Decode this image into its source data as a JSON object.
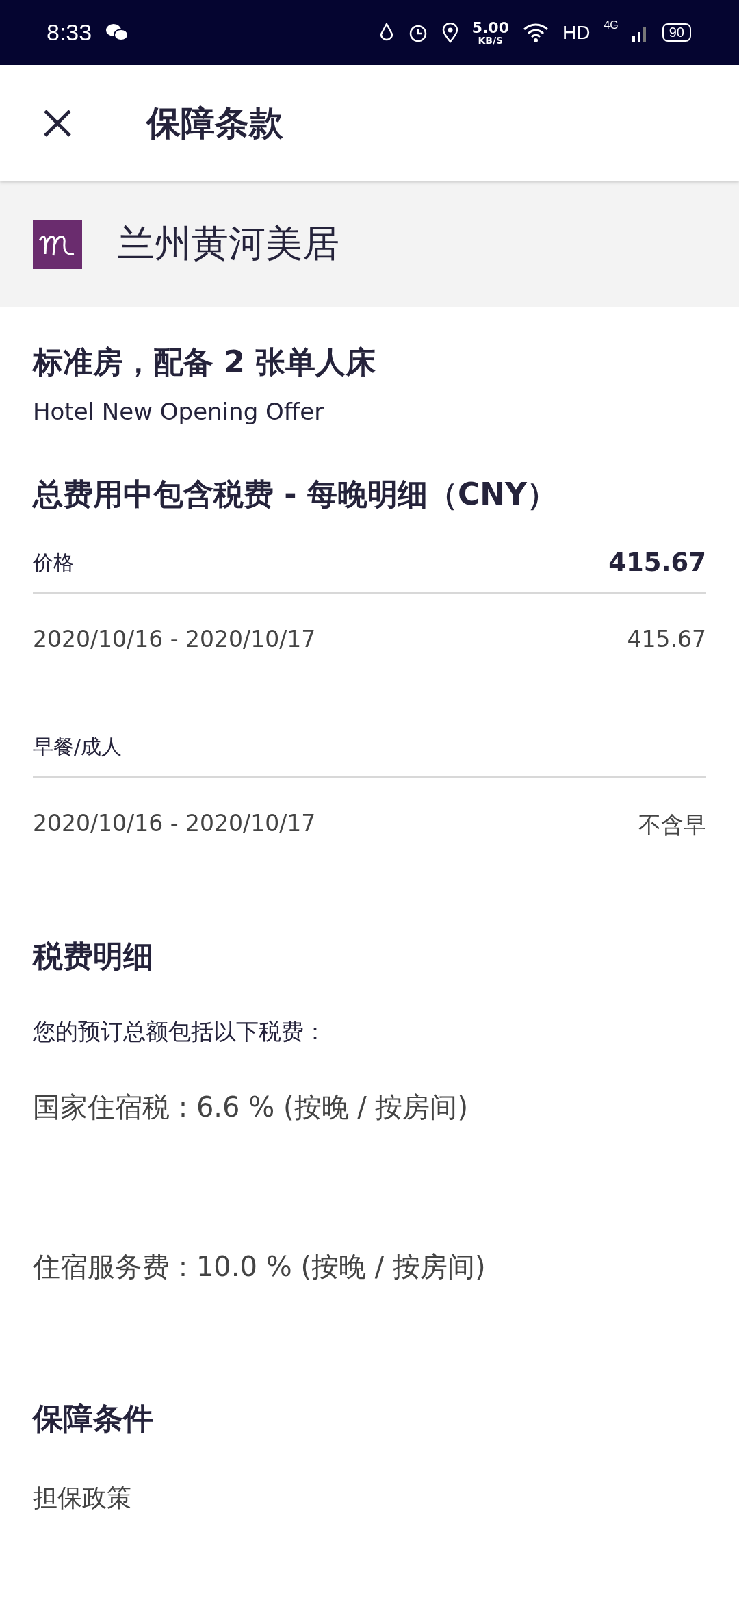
{
  "status_bar": {
    "time": "8:33",
    "speed": "5.00",
    "speed_unit": "KB/S",
    "hd": "HD",
    "network": "4G",
    "battery": "90"
  },
  "header": {
    "title": "保障条款"
  },
  "hotel": {
    "name": "兰州黄河美居"
  },
  "room": {
    "title": "标准房，配备 **2** 张单人床",
    "offer": "Hotel New Opening Offer"
  },
  "price_section": {
    "title": "总费用中包含税费 - 每晚明细（**CNY**）",
    "groups": [
      {
        "label": "价格",
        "total": "415.67",
        "rows": [
          {
            "dates": "2020/10/16 - 2020/10/17",
            "value": "415.67"
          }
        ]
      },
      {
        "label": "早餐/成人",
        "rows": [
          {
            "dates": "2020/10/16 - 2020/10/17",
            "value": "不含早"
          }
        ]
      }
    ]
  },
  "tax_section": {
    "title": "税费明细",
    "intro": "您的预订总额包括以下税费：",
    "items": [
      "国家住宿税 : 6.6 % (按晚 / 按房间)",
      "住宿服务费 : 10.0 % (按晚 / 按房间)"
    ]
  },
  "guarantee_section": {
    "title": "保障条件",
    "subtitle": "担保政策"
  }
}
